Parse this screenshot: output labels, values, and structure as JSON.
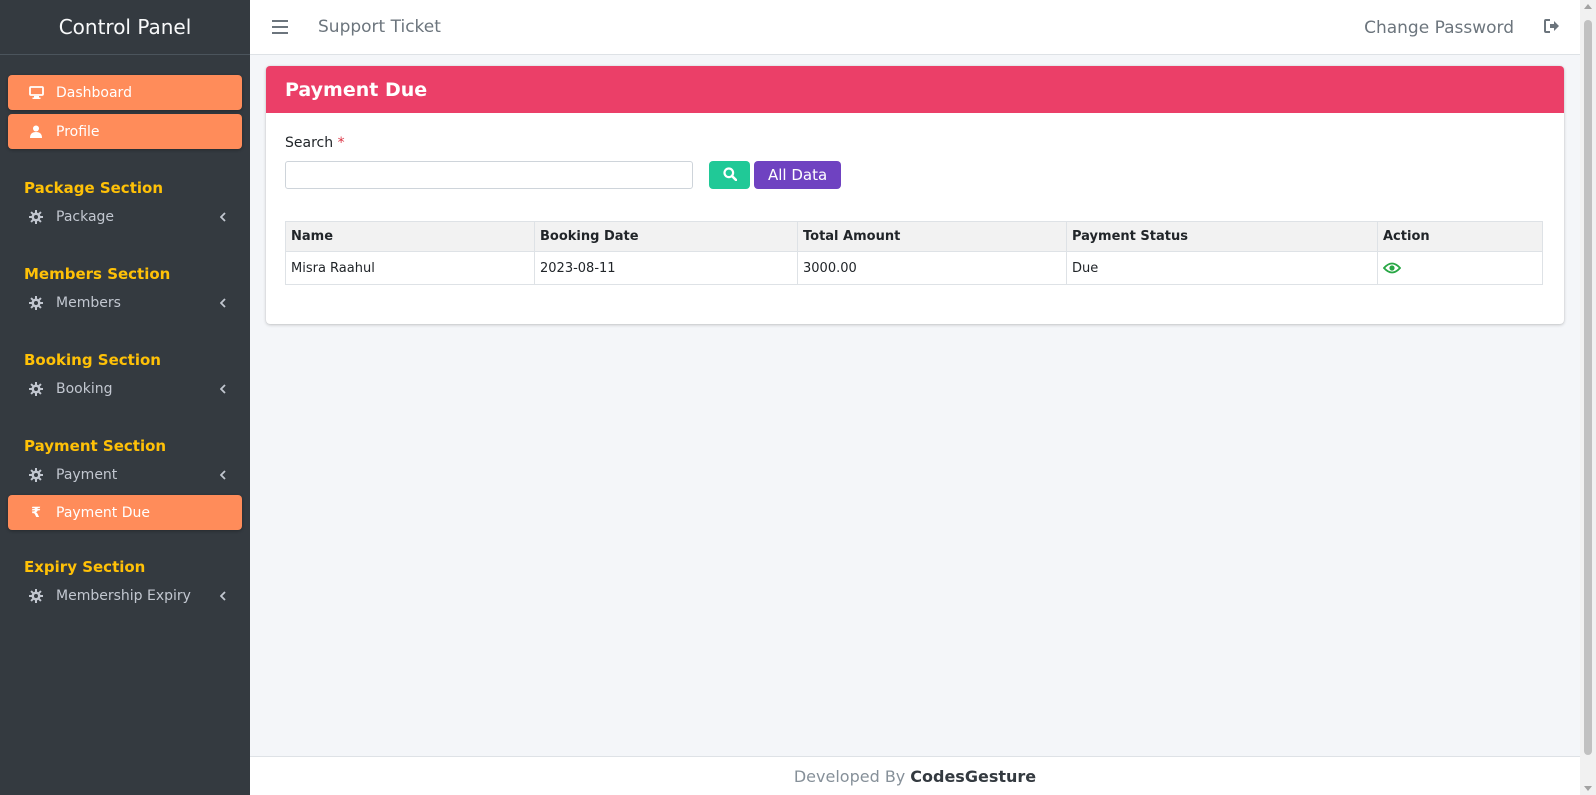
{
  "sidebar": {
    "brand": "Control Panel",
    "top_items": [
      {
        "label": "Dashboard",
        "icon": "desktop-icon"
      },
      {
        "label": "Profile",
        "icon": "user-icon"
      }
    ],
    "sections": [
      {
        "header": "Package Section",
        "item": "Package"
      },
      {
        "header": "Members Section",
        "item": "Members"
      },
      {
        "header": "Booking Section",
        "item": "Booking"
      },
      {
        "header": "Payment Section",
        "item": "Payment"
      },
      {
        "header": "Expiry Section",
        "item": "Membership Expiry"
      }
    ],
    "active_sub_item": {
      "label": "Payment Due",
      "icon": "rupee-icon"
    },
    "active_color": "#ff8c5a",
    "header_color": "#ffc107"
  },
  "topbar": {
    "support": "Support Ticket",
    "change_password": "Change Password"
  },
  "card": {
    "title": "Payment Due",
    "header_color": "#eb3f68",
    "search_label": "Search",
    "required_mark": "*",
    "all_data_button": "All Data"
  },
  "table": {
    "headers": [
      "Name",
      "Booking Date",
      "Total Amount",
      "Payment Status",
      "Action"
    ],
    "rows": [
      [
        "Misra Raahul",
        "2023-08-11",
        "3000.00",
        "Due"
      ]
    ]
  },
  "footer": {
    "prefix": "Developed By",
    "company": "CodesGesture"
  }
}
